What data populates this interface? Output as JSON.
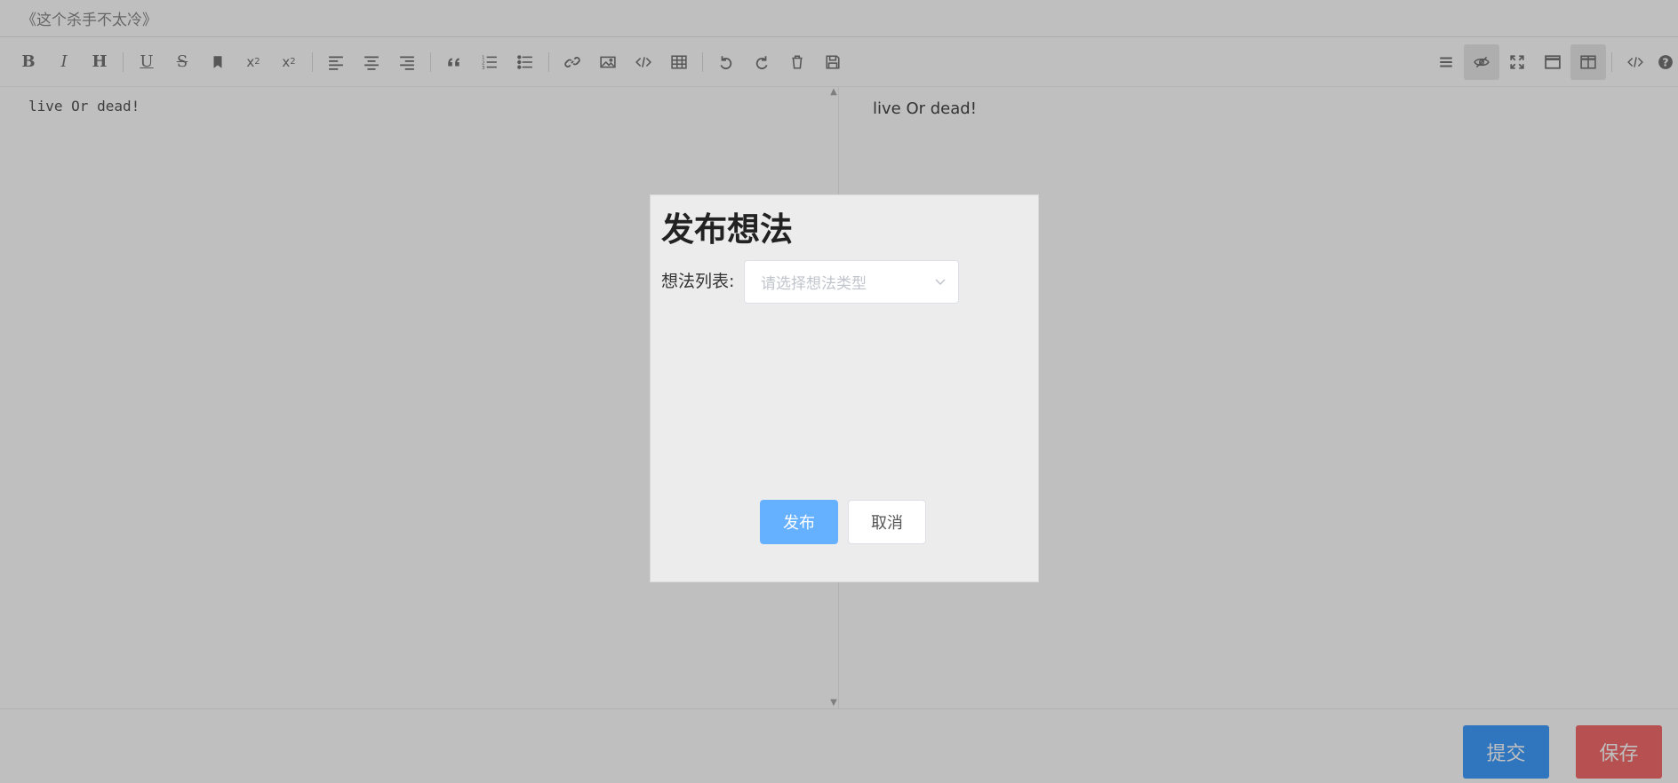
{
  "document": {
    "title": "《这个杀手不太冷》"
  },
  "toolbar": {
    "left_tools": [
      {
        "name": "bold-icon",
        "glyph": "B"
      },
      {
        "name": "italic-icon",
        "glyph": "I"
      },
      {
        "name": "heading-icon",
        "glyph": "H"
      },
      {
        "name": "underline-icon",
        "glyph": "U"
      },
      {
        "name": "strikethrough-icon",
        "glyph": "S"
      },
      {
        "name": "mark-icon",
        "glyph": "bookmark"
      },
      {
        "name": "superscript-icon",
        "glyph": "x²"
      },
      {
        "name": "subscript-icon",
        "glyph": "x₂"
      },
      {
        "name": "align-left-icon",
        "glyph": "align-left"
      },
      {
        "name": "align-center-icon",
        "glyph": "align-center"
      },
      {
        "name": "align-right-icon",
        "glyph": "align-right"
      },
      {
        "name": "quote-icon",
        "glyph": "quote"
      },
      {
        "name": "ordered-list-icon",
        "glyph": "ol"
      },
      {
        "name": "unordered-list-icon",
        "glyph": "ul"
      },
      {
        "name": "link-icon",
        "glyph": "link"
      },
      {
        "name": "image-icon",
        "glyph": "image"
      },
      {
        "name": "code-icon",
        "glyph": "code"
      },
      {
        "name": "table-icon",
        "glyph": "table"
      },
      {
        "name": "undo-icon",
        "glyph": "undo"
      },
      {
        "name": "redo-icon",
        "glyph": "redo"
      },
      {
        "name": "trash-icon",
        "glyph": "trash"
      },
      {
        "name": "save-icon",
        "glyph": "save"
      }
    ],
    "right_tools": [
      {
        "name": "navigation-icon",
        "glyph": "menu"
      },
      {
        "name": "preview-toggle-icon",
        "glyph": "eye",
        "active": true
      },
      {
        "name": "fullscreen-icon",
        "glyph": "expand"
      },
      {
        "name": "window-icon",
        "glyph": "window"
      },
      {
        "name": "split-view-icon",
        "glyph": "split",
        "active": true
      },
      {
        "name": "html-code-icon",
        "glyph": "code"
      },
      {
        "name": "help-icon",
        "glyph": "help"
      }
    ]
  },
  "editor": {
    "source_text": "live Or dead!",
    "preview_text": "live Or dead!"
  },
  "footer": {
    "submit_label": "提交",
    "save_label": "保存"
  },
  "dialog": {
    "title": "发布想法",
    "field_label": "想法列表:",
    "select_placeholder": "请选择想法类型",
    "publish_label": "发布",
    "cancel_label": "取消"
  },
  "colors": {
    "primary": "#409eff",
    "primary_light": "#66b1ff",
    "danger": "#f56c6c",
    "overlay": "rgba(0,0,0,0.25)",
    "dialog_bg": "#ececec"
  }
}
